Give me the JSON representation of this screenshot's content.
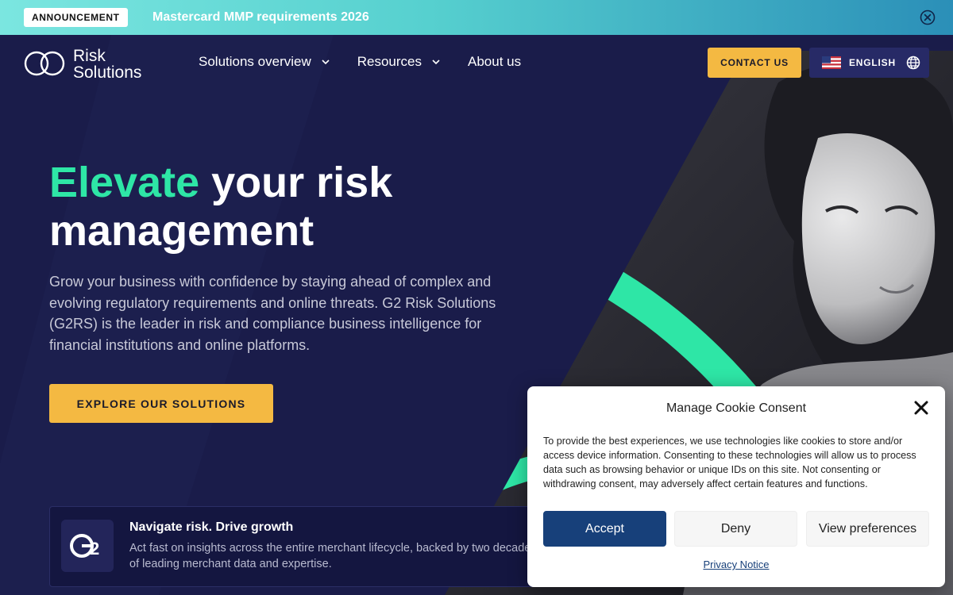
{
  "announcement": {
    "badge": "ANNOUNCEMENT",
    "link_text": "Mastercard MMP requirements 2026",
    "close_icon": "close-circle-icon"
  },
  "header": {
    "logo_text": "Risk Solutions",
    "logo_line1": "Risk",
    "logo_line2": "Solutions",
    "logo_mark": "G2",
    "nav": [
      {
        "label": "Solutions overview",
        "has_dropdown": true
      },
      {
        "label": "Resources",
        "has_dropdown": true
      },
      {
        "label": "About us",
        "has_dropdown": false
      }
    ],
    "contact_label": "CONTACT US",
    "language": {
      "label": "ENGLISH",
      "flag_icon": "us-flag-icon",
      "globe_icon": "globe-icon"
    }
  },
  "hero": {
    "title_accent": "Elevate",
    "title_rest": " your risk management",
    "description": "Grow your business with confidence by staying ahead of complex and evolving regulatory requirements and online threats. G2 Risk Solutions (G2RS) is the leader in risk and compliance business intelligence for financial institutions and online platforms.",
    "cta_label": "EXPLORE OUR SOLUTIONS"
  },
  "promo": {
    "icon_text": "G2",
    "title": "Navigate risk. Drive growth",
    "text": "Act fast on insights across the entire merchant lifecycle, backed by two decades of leading merchant data and expertise."
  },
  "cookie": {
    "title": "Manage Cookie Consent",
    "text": "To provide the best experiences, we use technologies like cookies to store and/or access device information. Consenting to these technologies will allow us to process data such as browsing behavior or unique IDs on this site. Not consenting or withdrawing consent, may adversely affect certain features and functions.",
    "accept_label": "Accept",
    "deny_label": "Deny",
    "preferences_label": "View preferences",
    "privacy_label": "Privacy Notice"
  },
  "colors": {
    "accent_green": "#2ee6a6",
    "cta_yellow": "#f4b942",
    "navy": "#1a1c4a",
    "accept_blue": "#17407a"
  }
}
